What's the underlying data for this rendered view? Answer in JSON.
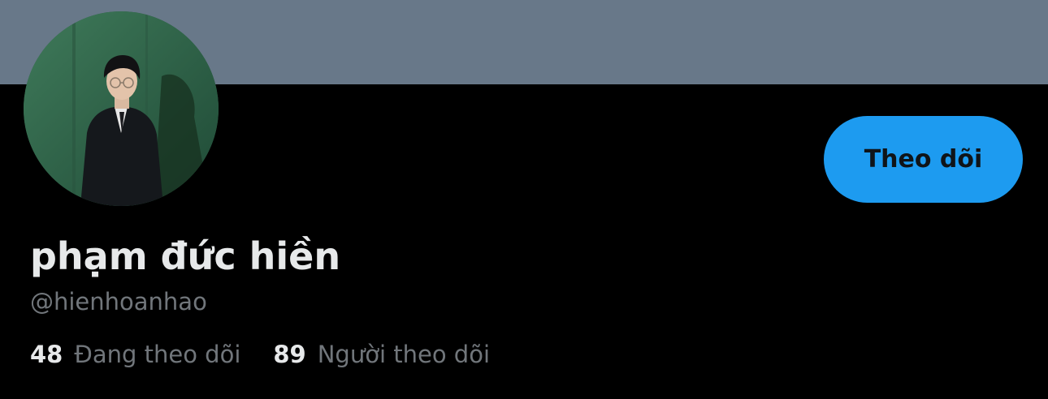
{
  "profile": {
    "display_name": "phạm đức hiền",
    "handle": "@hienhoanhao",
    "follow_button_label": "Theo dõi",
    "following_count": "48",
    "following_label": "Đang theo dõi",
    "followers_count": "89",
    "followers_label": "Người theo dõi"
  },
  "colors": {
    "banner": "#687889",
    "background": "#000000",
    "accent": "#1d9bf0",
    "primary_text": "#e7e9ea",
    "secondary_text": "#71767b"
  }
}
